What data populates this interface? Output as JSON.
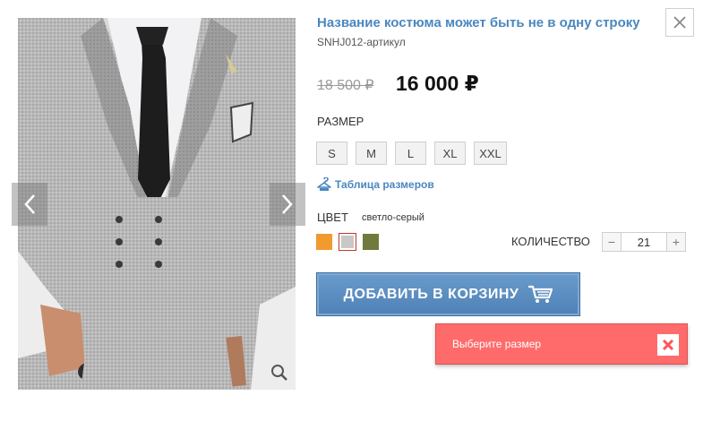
{
  "product": {
    "title": "Название костюма может быть не в одну строку",
    "sku": "SNHJ012-артикул",
    "old_price": "18 500 ₽",
    "price": "16 000 ₽"
  },
  "size": {
    "label": "РАЗМЕР",
    "options": [
      "S",
      "M",
      "L",
      "XL",
      "XXL"
    ],
    "table_link": "Таблица размеров"
  },
  "color": {
    "label": "ЦВЕТ",
    "value": "светло-серый",
    "swatches": [
      "#f29a2e",
      "#c8c8c8",
      "#6f7a3c"
    ],
    "selected_index": 1
  },
  "quantity": {
    "label": "КОЛИЧЕСТВО",
    "value": "21",
    "minus": "−",
    "plus": "+"
  },
  "cart": {
    "label": "ДОБАВИТЬ В КОРЗИНУ"
  },
  "toast": {
    "message": "Выберите размер"
  },
  "colors": {
    "link": "#4a87bf",
    "button": "#5a8bbf",
    "toast": "#ff6b6b"
  }
}
